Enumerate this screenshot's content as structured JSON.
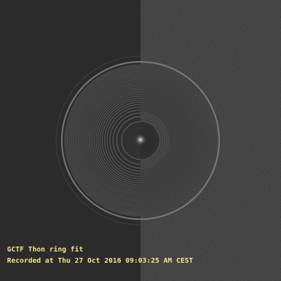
{
  "image": {
    "description_type": "ctf-power-spectrum",
    "colors": {
      "background_left": "#2b2b2b",
      "background_right": "#303030",
      "noise_light": "#3c3c3c",
      "noise_dark": "#262626",
      "ring": "#8a8a8a",
      "ring_faint": "#6e6e6e",
      "center_glow": "#e6e6e6",
      "caption_text": "#f5e48a"
    }
  },
  "captions": {
    "title": "GCTF Thon ring fit",
    "recorded": "Recorded at Thu 27 Oct 2016 09:03:25 AM CEST"
  }
}
